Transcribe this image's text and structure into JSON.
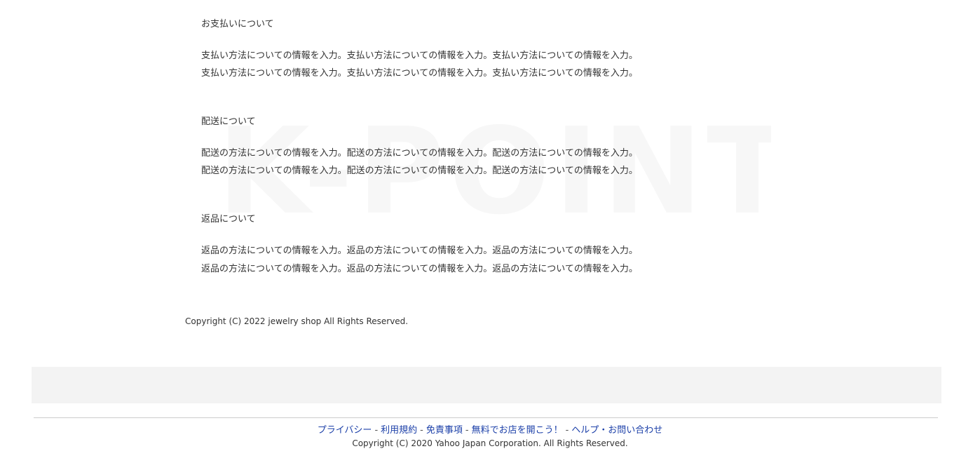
{
  "watermark": "K-POINT",
  "sections": [
    {
      "title": "お支払いについて",
      "lines": [
        "支払い方法についての情報を入力。支払い方法についての情報を入力。支払い方法についての情報を入力。",
        "支払い方法についての情報を入力。支払い方法についての情報を入力。支払い方法についての情報を入力。"
      ]
    },
    {
      "title": "配送について",
      "lines": [
        "配送の方法についての情報を入力。配送の方法についての情報を入力。配送の方法についての情報を入力。",
        "配送の方法についての情報を入力。配送の方法についての情報を入力。配送の方法についての情報を入力。"
      ]
    },
    {
      "title": "返品について",
      "lines": [
        "返品の方法についての情報を入力。返品の方法についての情報を入力。返品の方法についての情報を入力。",
        "返品の方法についての情報を入力。返品の方法についての情報を入力。返品の方法についての情報を入力。"
      ]
    }
  ],
  "shop_copyright": "Copyright (C) 2022 jewelry shop All Rights Reserved.",
  "footer": {
    "links": [
      "プライバシー",
      "利用規約",
      "免責事項",
      "無料でお店を開こう！",
      "ヘルプ・お問い合わせ"
    ],
    "separator": "-",
    "copyright": "Copyright (C) 2020 Yahoo Japan Corporation. All Rights Reserved."
  },
  "colors": {
    "text": "#333333",
    "link": "#1b3fa8",
    "band": "#f3f3f3",
    "watermark": "#f7f7f7"
  }
}
